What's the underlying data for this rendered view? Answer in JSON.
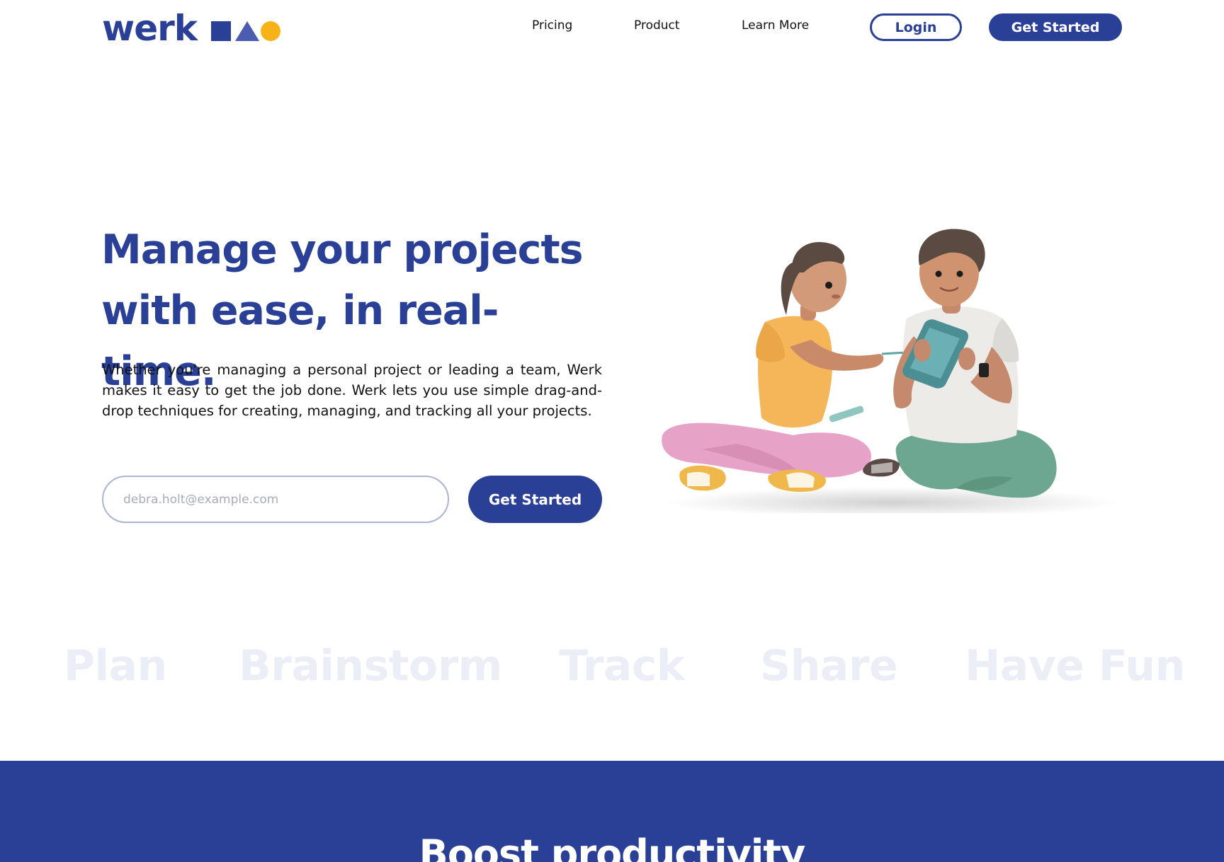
{
  "brand": {
    "name": "werk",
    "colors": {
      "primary": "#2a3f96",
      "secondary": "#4a5db0",
      "accent": "#f7b316",
      "muted_words": "#eceef7"
    }
  },
  "nav": {
    "links": [
      "Pricing",
      "Product",
      "Learn More"
    ],
    "login_label": "Login",
    "get_started_label": "Get Started"
  },
  "hero": {
    "title_line1": "Manage your projects",
    "title_line2": "with ease, in real-time.",
    "description": "Whether you're managing a personal project or leading a team, Werk makes it easy to get the job done. Werk lets you use simple drag-and-drop techniques for creating, managing, and tracking all your projects.",
    "email_placeholder": "debra.holt@example.com",
    "cta_label": "Get Started",
    "illustration_icon": "two-people-with-tablet-illustration"
  },
  "features_strip": [
    "Plan",
    "Brainstorm",
    "Track",
    "Share",
    "Have Fun"
  ],
  "band": {
    "title": "Boost productivity"
  }
}
